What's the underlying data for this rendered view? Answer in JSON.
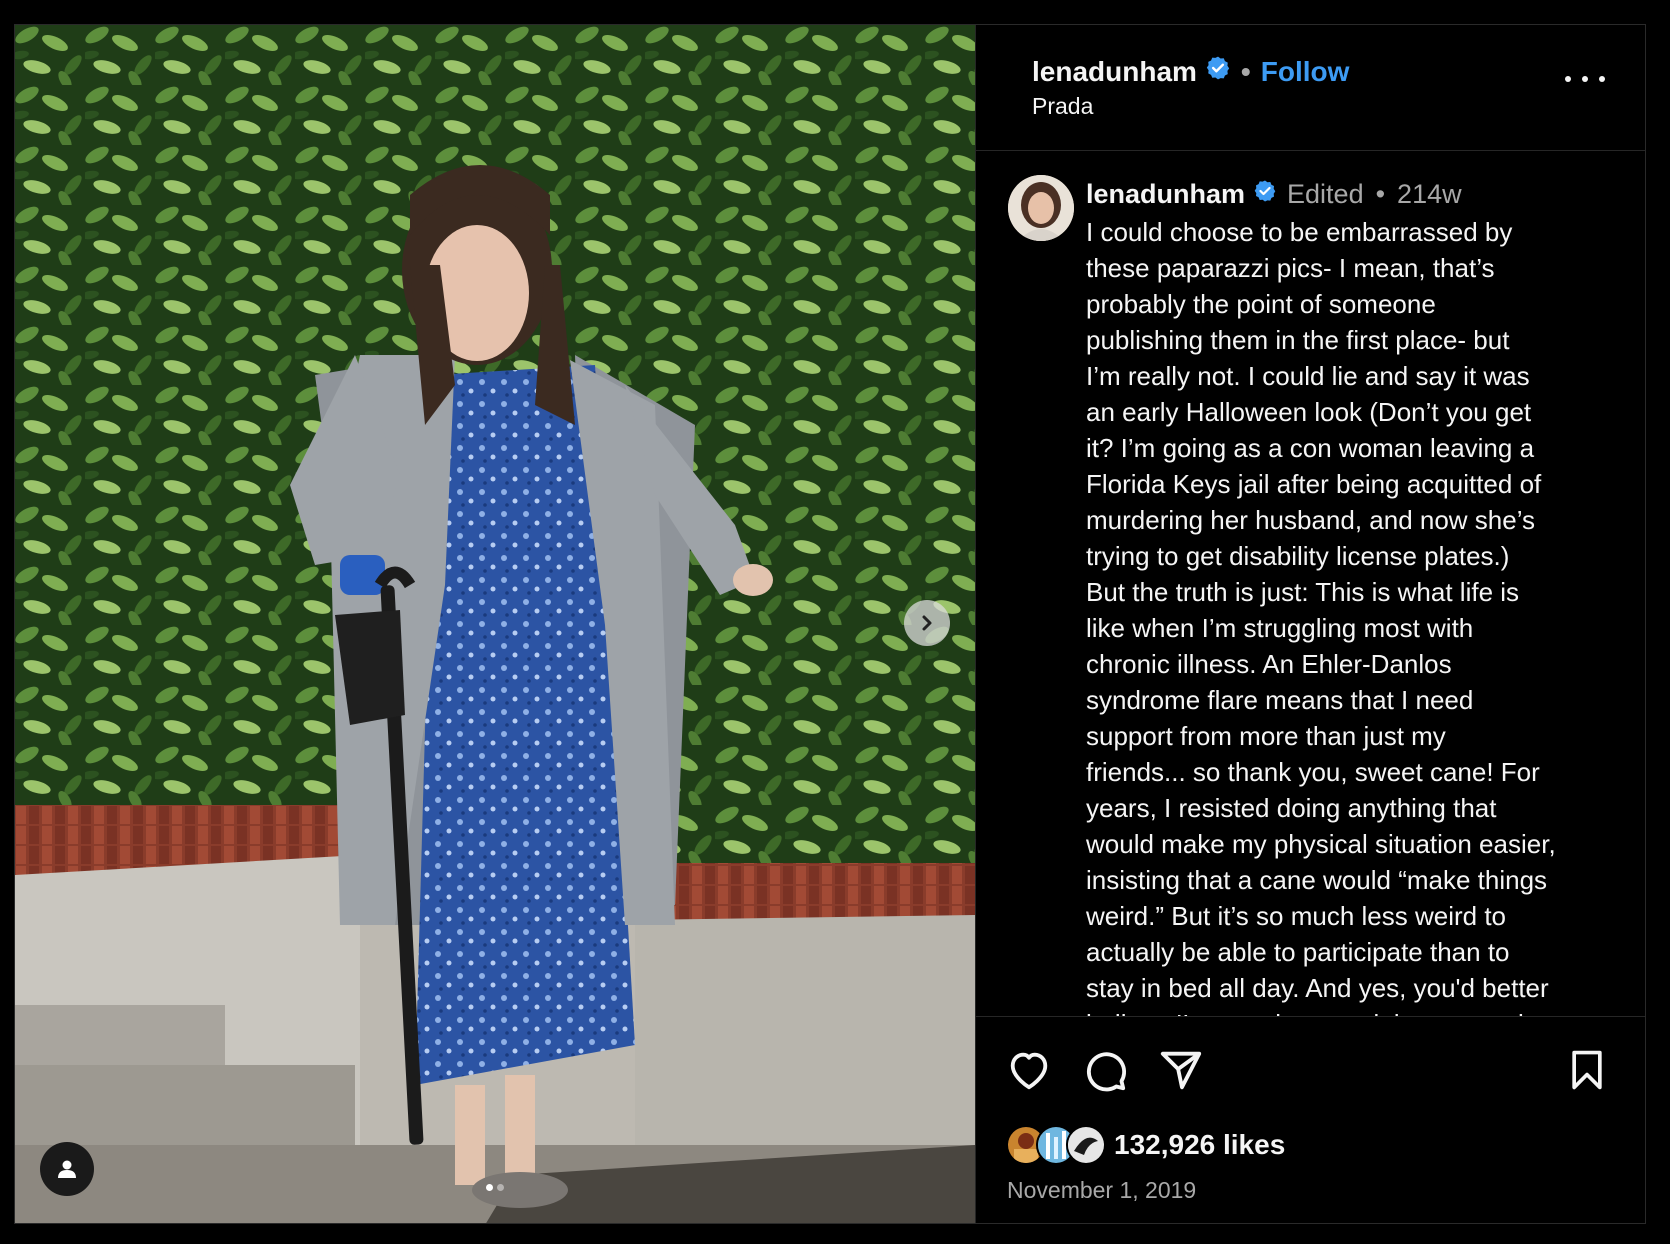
{
  "header": {
    "username": "lenadunham",
    "separator": "•",
    "follow_label": "Follow",
    "location": "Prada"
  },
  "caption": {
    "username": "lenadunham",
    "edited_label": "Edited",
    "separator": "•",
    "time_ago": "214w",
    "text": "I could choose to be embarrassed by\nthese paparazzi pics- I mean, that’s\nprobably the point of someone\npublishing them in the first place- but\nI’m really not. I could lie and say it was\nan early Halloween look (Don’t you get\nit? I’m going as a con woman leaving a\nFlorida Keys jail after being acquitted of\nmurdering her husband, and now she’s\ntrying to get disability license plates.)\nBut the truth is just: This is what life is\nlike when I’m struggling most with\nchronic illness. An Ehler-Danlos\nsyndrome flare means that I need\nsupport from more than just my\nfriends... so thank you, sweet cane! For\nyears, I resisted doing anything that\nwould make my physical situation easier,\ninsisting that a cane would “make things\nweird.” But it’s so much less weird to\nactually be able to participate than to\nstay in bed all day. And yes, you'd better\nbelieve I’m carrying my nightgown style"
  },
  "stats": {
    "likes": "132,926 likes",
    "date": "November 1, 2019"
  },
  "icons": {
    "verified": "verified-badge-icon",
    "more": "more-options-icon",
    "like": "heart-icon",
    "comment": "comment-bubble-icon",
    "share": "paper-plane-icon",
    "save": "bookmark-icon",
    "next": "chevron-right-icon",
    "tag": "user-tag-icon"
  },
  "colors": {
    "accent": "#3d9bf3",
    "background": "#000000",
    "muted_text": "#a8a8a8"
  },
  "carousel": {
    "slides": 2,
    "active_slide": 1
  }
}
